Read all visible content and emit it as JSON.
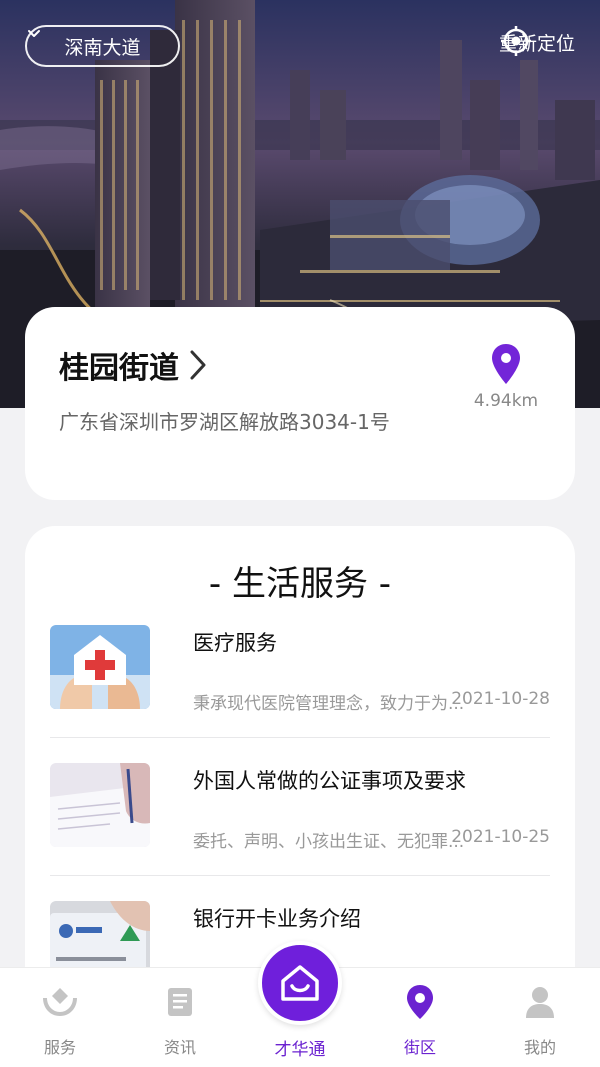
{
  "header": {
    "location_selector": "深南大道",
    "relocate_label": "重新定位"
  },
  "street_card": {
    "name": "桂园街道",
    "address": "广东省深圳市罗湖区解放路3034-1号",
    "distance": "4.94km"
  },
  "services": {
    "heading": "- 生活服务 -",
    "items": [
      {
        "title": "医疗服务",
        "desc": "秉承现代医院管理理念，致力于为...",
        "date": "2021-10-28",
        "icon": "hospital-hands-image"
      },
      {
        "title": "外国人常做的公证事项及要求",
        "desc": "委托、声明、小孩出生证、无犯罪...",
        "date": "2021-10-25",
        "icon": "document-signing-image"
      },
      {
        "title": "银行开卡业务介绍",
        "desc": "",
        "date": "",
        "icon": "bank-card-image"
      }
    ]
  },
  "nav": {
    "items": [
      {
        "label": "服务",
        "icon": "service-hands-icon"
      },
      {
        "label": "资讯",
        "icon": "news-icon"
      },
      {
        "label": "才华通",
        "icon": "home-smile-icon"
      },
      {
        "label": "街区",
        "icon": "location-pin-icon"
      },
      {
        "label": "我的",
        "icon": "user-icon"
      }
    ],
    "active": "街区"
  },
  "colors": {
    "accent": "#6f1fdb",
    "active_text": "#6b22d0",
    "inactive": "#bdbdbd"
  }
}
